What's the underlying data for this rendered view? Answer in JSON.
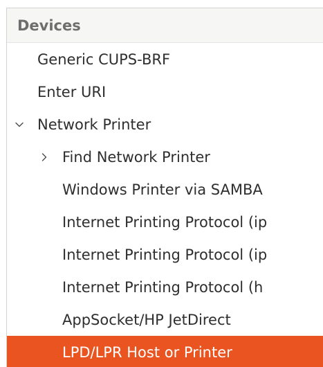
{
  "tree": {
    "header": "Devices",
    "items": [
      {
        "label": "Generic CUPS-BRF",
        "level": 0
      },
      {
        "label": "Enter URI",
        "level": 0
      },
      {
        "label": "Network Printer",
        "level": 0,
        "expander": "expanded"
      },
      {
        "label": "Find Network Printer",
        "level": 1,
        "expander": "collapsed"
      },
      {
        "label": "Windows Printer via SAMBA",
        "level": 1
      },
      {
        "label": "Internet Printing Protocol (ip",
        "level": 1
      },
      {
        "label": "Internet Printing Protocol (ip",
        "level": 1
      },
      {
        "label": "Internet Printing Protocol (h",
        "level": 1
      },
      {
        "label": "AppSocket/HP JetDirect",
        "level": 1
      },
      {
        "label": "LPD/LPR Host or Printer",
        "level": 1,
        "selected": true
      }
    ]
  },
  "colors": {
    "selection": "#e95420",
    "header_text": "#6e6e6e",
    "item_text": "#2e2e2e"
  },
  "icons": {
    "expanded": "chevron-down-icon",
    "collapsed": "chevron-right-icon"
  }
}
